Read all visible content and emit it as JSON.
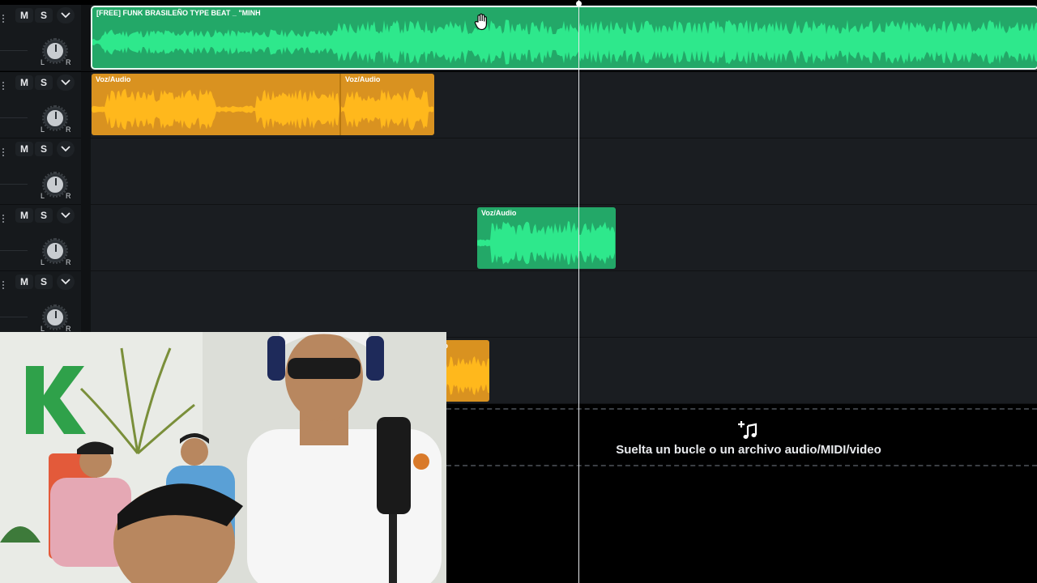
{
  "tracks": [
    {
      "mute": "M",
      "solo": "S",
      "pan_left": "L",
      "pan_right": "R"
    },
    {
      "mute": "M",
      "solo": "S",
      "pan_left": "L",
      "pan_right": "R"
    },
    {
      "mute": "M",
      "solo": "S",
      "pan_left": "L",
      "pan_right": "R"
    },
    {
      "mute": "M",
      "solo": "S",
      "pan_left": "L",
      "pan_right": "R"
    },
    {
      "mute": "M",
      "solo": "S",
      "pan_left": "L",
      "pan_right": "R"
    }
  ],
  "clips": {
    "beat_title": "[FREE] FUNK BRASILEÑO TYPE BEAT _ \"MINH",
    "voz_a_title": "Voz/Audio",
    "voz_b_title": "Voz/Audio",
    "voz_c_title": "Voz/Audio",
    "voz_d_title": "io"
  },
  "drop_zone": {
    "text": "Suelta un bucle o un archivo audio/MIDI/video",
    "icon": "add-music-icon"
  },
  "colors": {
    "clip_green": "#23a868",
    "clip_orange": "#d99220",
    "background": "#1a1d21"
  }
}
